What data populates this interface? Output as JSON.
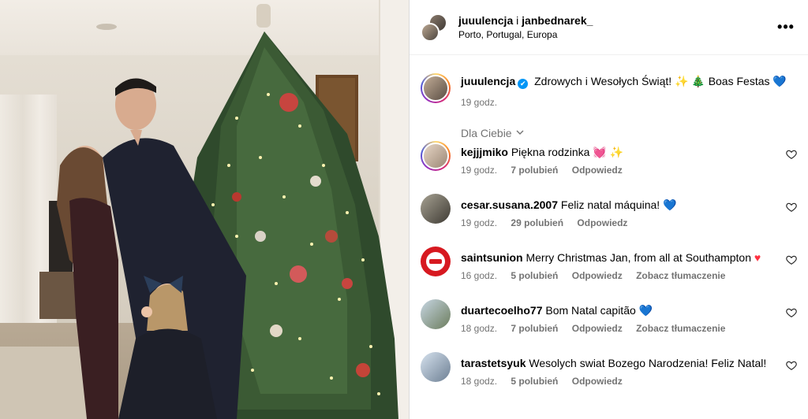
{
  "header": {
    "user1": "juuulencja",
    "conjunction": "i",
    "user2": "janbednarek_",
    "location": "Porto, Portugal, Europa",
    "more_label": "•••"
  },
  "caption": {
    "username": "juuulencja",
    "verified_mark": "✔",
    "text": "Zdrowych i Wesołych Świąt!",
    "emoji_spark": "✨",
    "emoji_tree": "🎄",
    "text2": "Boas Festas",
    "emoji_heart": "💙",
    "time": "19 godz."
  },
  "filter": {
    "label": "Dla Ciebie",
    "chevron": "⌄"
  },
  "comments": [
    {
      "username": "kejjjmiko",
      "text": "Piękna rodzinka",
      "emoji": "💓 ✨",
      "time": "19 godz.",
      "likes": "7 polubień",
      "reply": "Odpowiedz",
      "translate": "",
      "ring": true
    },
    {
      "username": "cesar.susana.2007",
      "text": "Feliz natal máquina!",
      "emoji": "💙",
      "time": "19 godz.",
      "likes": "29 polubień",
      "reply": "Odpowiedz",
      "translate": "",
      "ring": false
    },
    {
      "username": "saintsunion",
      "text": "Merry Christmas Jan, from all at Southampton",
      "emoji": "♥",
      "time": "16 godz.",
      "likes": "5 polubień",
      "reply": "Odpowiedz",
      "translate": "Zobacz tłumaczenie",
      "ring": false
    },
    {
      "username": "duartecoelho77",
      "text": "Bom Natal capitão",
      "emoji": "💙",
      "time": "18 godz.",
      "likes": "7 polubień",
      "reply": "Odpowiedz",
      "translate": "Zobacz tłumaczenie",
      "ring": false
    },
    {
      "username": "tarastetsyuk",
      "text": "Wesolych swiat Bozego Narodzenia! Feliz Natal!",
      "emoji": "",
      "time": "18 godz.",
      "likes": "5 polubień",
      "reply": "Odpowiedz",
      "translate": "",
      "ring": false
    }
  ],
  "colors": {
    "accent_blue": "#0095f6",
    "meta_gray": "#737373",
    "heart_red": "#ff3040",
    "divider": "#dbdbdb"
  },
  "icons": {
    "header_more": "more-horizontal-icon",
    "comment_like": "heart-outline-icon",
    "filter_chevron": "chevron-down-icon",
    "verified": "verified-badge-icon"
  }
}
